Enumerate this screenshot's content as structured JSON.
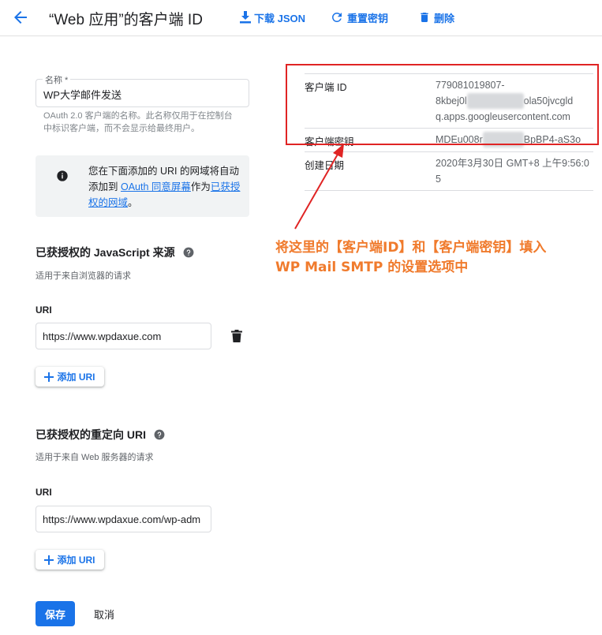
{
  "header": {
    "title": "“Web 应用”的客户端 ID",
    "download_label": "下载 JSON",
    "reset_label": "重置密钥",
    "delete_label": "删除"
  },
  "name_field": {
    "label": "名称 *",
    "value": "WP大学邮件发送",
    "help": "OAuth 2.0 客户端的名称。此名称仅用于在控制台中标识客户端，而不会显示给最终用户。"
  },
  "info": {
    "text_before": "您在下面添加的 URI 的网域将自动添加到 ",
    "link1": "OAuth 同意屏幕",
    "text_middle": "作为",
    "link2": "已获授权的网域",
    "text_after": "。"
  },
  "js_origins": {
    "title": "已获授权的 JavaScript 来源",
    "desc": "适用于来自浏览器的请求",
    "uri_label": "URI",
    "uri_value": "https://www.wpdaxue.com",
    "add_label": "添加 URI"
  },
  "redirect_uris": {
    "title": "已获授权的重定向 URI",
    "desc": "适用于来自 Web 服务器的请求",
    "uri_label": "URI",
    "uri_value": "https://www.wpdaxue.com/wp-adm",
    "add_label": "添加 URI"
  },
  "actions": {
    "save_label": "保存",
    "cancel_label": "取消"
  },
  "credentials": {
    "client_id_label": "客户端 ID",
    "client_id_part1": "779081019807-",
    "client_id_part2": "8kbej0l",
    "client_id_part3": "ola50jvcgld",
    "client_id_part4": "q.apps.googleusercontent.com",
    "secret_label": "客户端密钥",
    "secret_part1": "MDEu008r",
    "secret_part2": "BpBP4-aS3o",
    "created_label": "创建日期",
    "created_value": "2020年3月30日 GMT+8 上午9:56:05"
  },
  "annotation": {
    "line1": "将这里的【客户端ID】和【客户端密钥】填入",
    "line2": "WP Mail SMTP 的设置选项中"
  },
  "colors": {
    "accent": "#1a73e8",
    "highlight": "#e02424",
    "annotation": "#f07b2d"
  },
  "icons": {
    "back": "arrow-back-icon",
    "download": "download-icon",
    "reset": "refresh-icon",
    "delete": "trash-icon",
    "info": "info-icon",
    "help": "help-icon",
    "add": "plus-icon"
  }
}
